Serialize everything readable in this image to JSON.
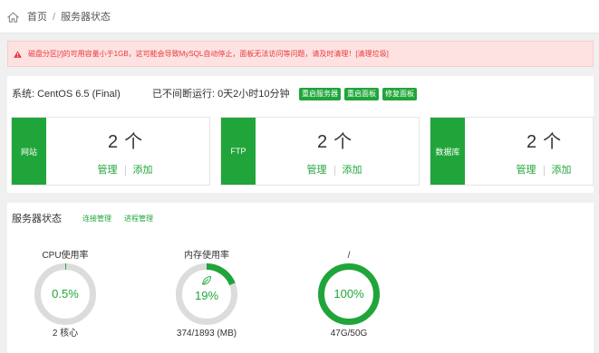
{
  "colors": {
    "accent": "#20a53a",
    "danger": "#e8383d",
    "alert_bg": "#fde2e1",
    "ring": "#dcdcdc"
  },
  "breadcrumb": {
    "home_icon": "home-icon",
    "home": "首页",
    "separator": "/",
    "current": "服务器状态"
  },
  "alert": {
    "icon": "warning-icon",
    "message": "磁盘分区[/]的可用容量小于1GB，这可能会导致MySQL自动停止，面板无法访问等问题，请及时清理！",
    "action": "[清理垃圾]"
  },
  "system": {
    "os_label": "系统:",
    "os_value": "CentOS 6.5 (Final)",
    "uptime_label": "已不间断运行:",
    "uptime_value": "0天2小时10分钟",
    "buttons": [
      "重启服务器",
      "重启面板",
      "修复面板"
    ]
  },
  "cards": [
    {
      "label": "网站",
      "count": "2",
      "unit": "个",
      "manage": "管理",
      "add": "添加"
    },
    {
      "label": "FTP",
      "count": "2",
      "unit": "个",
      "manage": "管理",
      "add": "添加"
    },
    {
      "label": "数据库",
      "count": "2",
      "unit": "个",
      "manage": "管理",
      "add": "添加"
    }
  ],
  "server_status": {
    "title": "服务器状态",
    "links": [
      "连接管理",
      "进程管理"
    ],
    "gauges": [
      {
        "label": "CPU使用率",
        "percent": 0.5,
        "value_text": "0.5%",
        "detail": "2 核心"
      },
      {
        "label": "内存使用率",
        "percent": 19,
        "value_text": "19%",
        "detail": "374/1893 (MB)",
        "icon": "leaf-icon"
      },
      {
        "label": "/",
        "percent": 100,
        "value_text": "100%",
        "detail": "47G/50G"
      }
    ]
  }
}
